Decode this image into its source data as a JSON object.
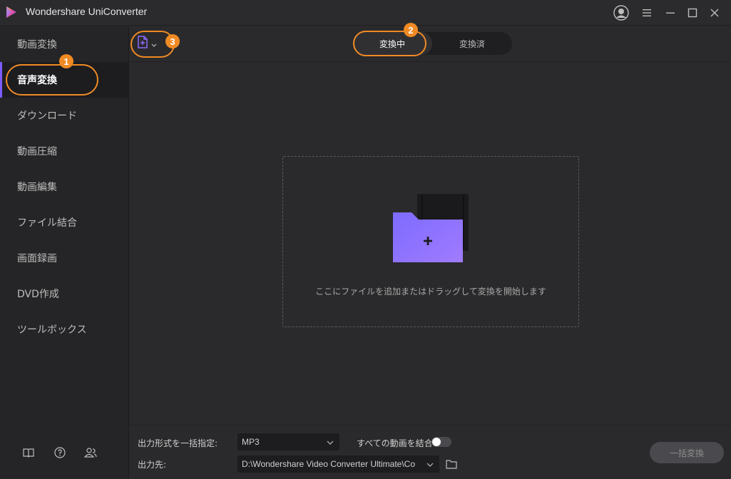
{
  "titlebar": {
    "app_title": "Wondershare UniConverter",
    "logo_icon": "uniconverter-logo-icon",
    "controls": [
      "account-icon",
      "menu-icon",
      "minimize-icon",
      "maximize-icon",
      "close-icon"
    ]
  },
  "sidebar": {
    "items": [
      {
        "label": "動画変換"
      },
      {
        "label": "音声変換",
        "active": true
      },
      {
        "label": "ダウンロード"
      },
      {
        "label": "動画圧縮"
      },
      {
        "label": "動画編集"
      },
      {
        "label": "ファイル結合"
      },
      {
        "label": "画面録画"
      },
      {
        "label": "DVD作成"
      },
      {
        "label": "ツールボックス"
      }
    ],
    "bottom_icons": [
      "book-icon",
      "help-icon",
      "users-icon"
    ]
  },
  "toolbar": {
    "add_file_icon": "add-file-icon",
    "tabs": [
      {
        "label": "変換中",
        "active": true
      },
      {
        "label": "変換済",
        "active": false
      }
    ]
  },
  "annotations": [
    "1",
    "2",
    "3"
  ],
  "dropzone": {
    "icon": "add-folder-icon",
    "text": "ここにファイルを追加またはドラッグして変換を開始します"
  },
  "bottom": {
    "format_label": "出力形式を一括指定:",
    "format_value": "MP3",
    "merge_label": "すべての動画を結合",
    "merge_on": false,
    "dest_label": "出力先:",
    "dest_value": "D:\\Wondershare Video Converter Ultimate\\Co",
    "convert_all_label": "一括変換"
  },
  "colors": {
    "accent": "#7b5cff",
    "annotation": "#f08a24",
    "background": "#2a2a2c",
    "sidebar": "#252527"
  }
}
